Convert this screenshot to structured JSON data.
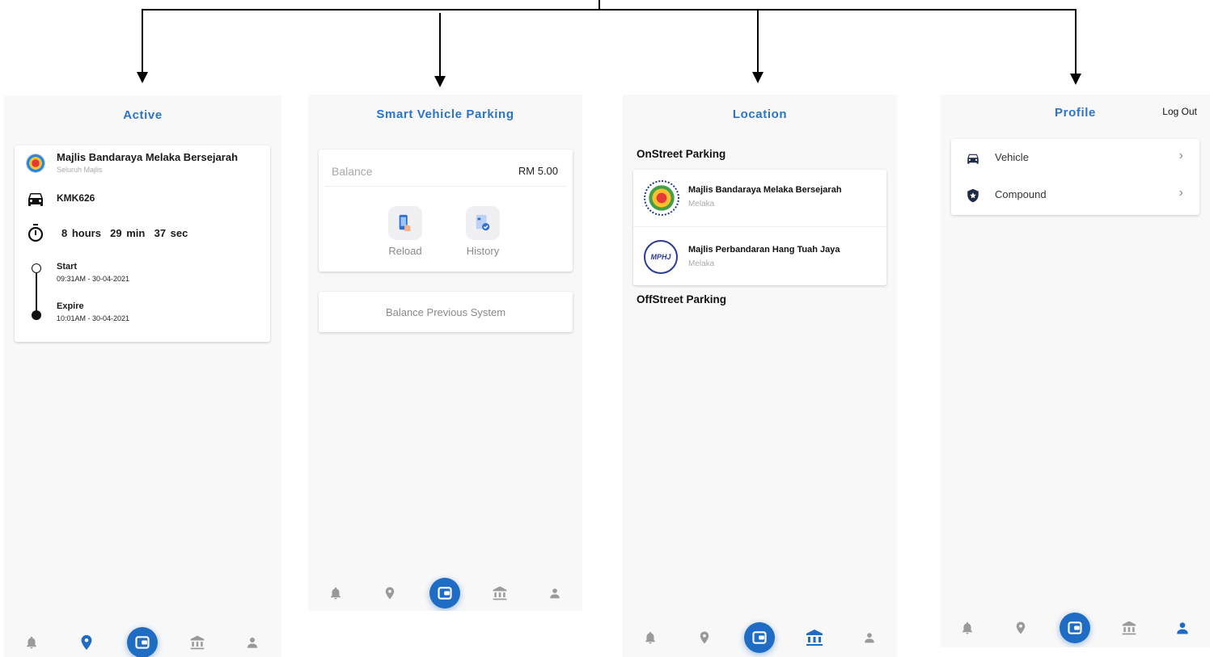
{
  "colors": {
    "accent": "#2b74c6",
    "fab": "#1f6cc4",
    "inactive_icon": "#9a9a9a"
  },
  "screen_active": {
    "title": "Active",
    "org_name": "Majlis Bandaraya Melaka Bersejarah",
    "org_sub": "Seluruh Majlis",
    "plate": "KMK626",
    "duration": "8 hours  29 min  37 sec",
    "start_label": "Start",
    "start_time": "09:31AM - 30-04-2021",
    "expire_label": "Expire",
    "expire_time": "10:01AM - 30-04-2021"
  },
  "screen_wallet": {
    "title": "Smart Vehicle Parking",
    "balance_label": "Balance",
    "balance_value": "RM 5.00",
    "reload_label": "Reload",
    "history_label": "History",
    "prev_balance_label": "Balance Previous System"
  },
  "screen_location": {
    "title": "Location",
    "onstreet_label": "OnStreet Parking",
    "offstreet_label": "OffStreet Parking",
    "locations": [
      {
        "name": "Majlis Bandaraya Melaka Bersejarah",
        "state": "Melaka"
      },
      {
        "name": "Majlis Perbandaran Hang Tuah Jaya",
        "state": "Melaka"
      }
    ],
    "mpht_logo_text": "MPHJ"
  },
  "screen_profile": {
    "title": "Profile",
    "logout_label": "Log Out",
    "items": [
      {
        "label": "Vehicle",
        "icon": "car-icon"
      },
      {
        "label": "Compound",
        "icon": "shield-star-icon"
      }
    ]
  },
  "nav_icons": [
    "bell-icon",
    "location-pin-icon",
    "wallet-icon",
    "bank-icon",
    "person-icon"
  ]
}
